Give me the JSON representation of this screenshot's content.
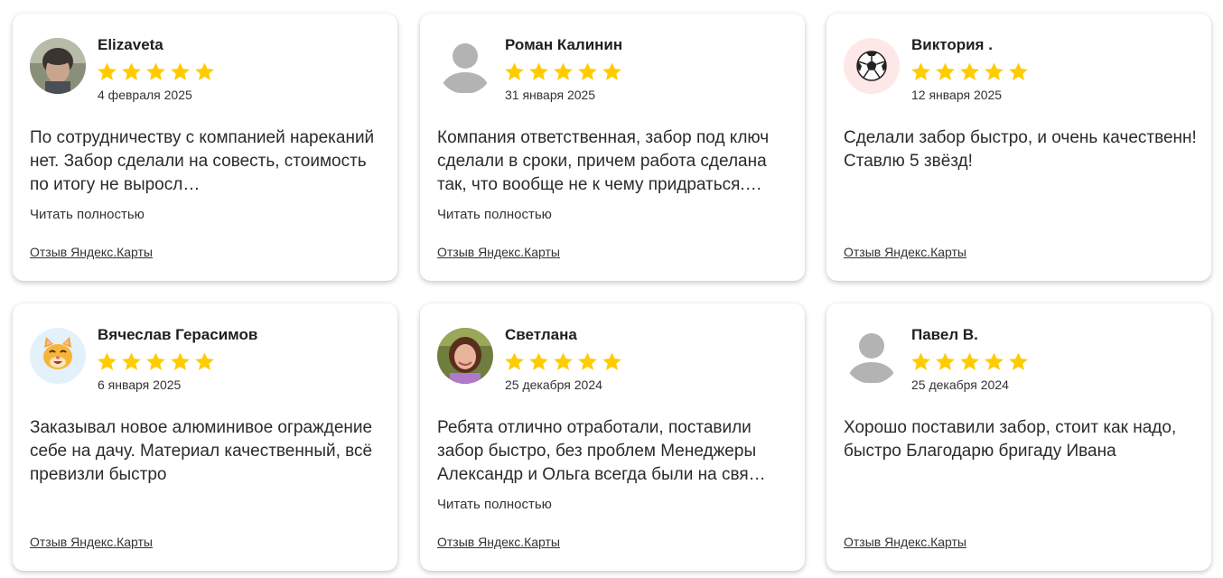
{
  "reviews": [
    {
      "name": "Elizaveta",
      "rating": 5,
      "date": "4 февраля 2025",
      "text": "По сотрудничеству с компанией нареканий нет. Забор сделали на совесть, стоимость по итогу не выросл…",
      "read_more": "Читать полностью",
      "source": "Отзыв Яндекс.Карты",
      "avatar": "user-photo"
    },
    {
      "name": "Роман Калинин",
      "rating": 5,
      "date": "31 января 2025",
      "text": "Компания ответственная, забор под ключ сделали в сроки, причем работа сделана так, что вообще не к чему придраться.…",
      "read_more": "Читать полностью",
      "source": "Отзыв Яндекс.Карты",
      "avatar": "default-user-icon"
    },
    {
      "name": "Виктория .",
      "rating": 5,
      "date": "12 января 2025",
      "text": "Сделали забор быстро, и очень качественн! Ставлю 5 звёзд!",
      "read_more": "",
      "source": "Отзыв Яндекс.Карты",
      "avatar": "soccer-ball-icon"
    },
    {
      "name": "Вячеслав Герасимов",
      "rating": 5,
      "date": "6 января 2025",
      "text": "Заказывал новое алюминивое ограждение себе на дачу. Материал качественный, всё превизли быстро",
      "read_more": "",
      "source": "Отзыв Яндекс.Карты",
      "avatar": "cat-face-icon"
    },
    {
      "name": "Светлана",
      "rating": 5,
      "date": "25 декабря 2024",
      "text": "Ребята отлично отработали, поставили забор быстро, без проблем Менеджеры Александр и Ольга всегда были на свя…",
      "read_more": "Читать полностью",
      "source": "Отзыв Яндекс.Карты",
      "avatar": "user-photo"
    },
    {
      "name": "Павел В.",
      "rating": 5,
      "date": "25 декабря 2024",
      "text": "Хорошо поставили забор, стоит как надо, быстро Благодарю бригаду Ивана",
      "read_more": "",
      "source": "Отзыв Яндекс.Карты",
      "avatar": "default-user-icon"
    }
  ],
  "colors": {
    "star": "#FFCC00",
    "card_bg": "#FFFFFF",
    "text": "#2B2B2B",
    "default_avatar": "#B3B3B3"
  }
}
